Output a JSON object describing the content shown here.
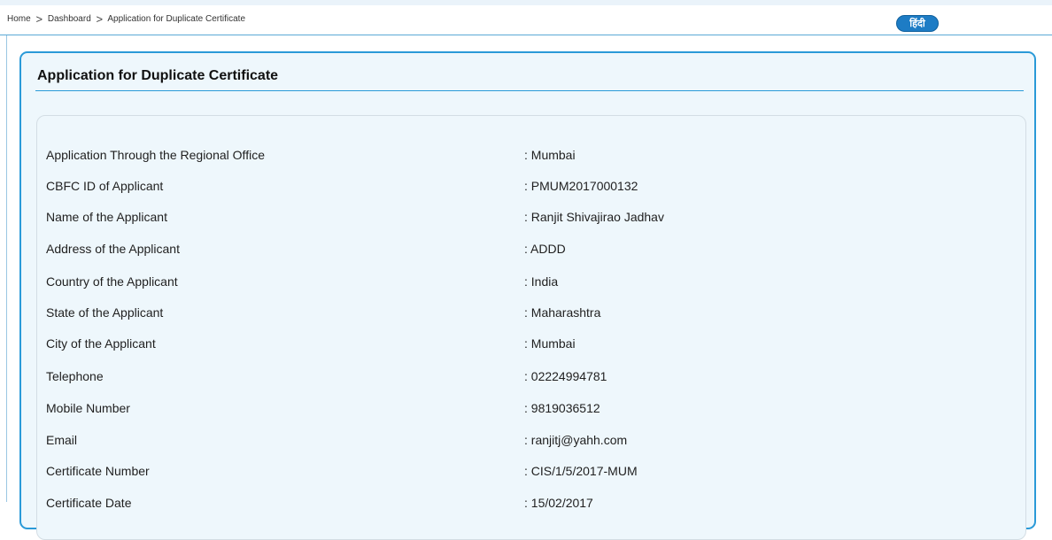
{
  "breadcrumb": {
    "home": "Home",
    "separator": ">",
    "dashboard": "Dashboard",
    "current": "Application for Duplicate Certificate"
  },
  "language_button": "हिंदी",
  "panel": {
    "title": "Application for Duplicate Certificate"
  },
  "details": [
    {
      "label": "Application Through the Regional Office",
      "value": ": Mumbai"
    },
    {
      "label": "CBFC ID of Applicant",
      "value": ": PMUM2017000132"
    },
    {
      "label": "Name of the Applicant",
      "value": ": Ranjit Shivajirao Jadhav"
    },
    {
      "label": "Address of the Applicant",
      "value": ": ADDD"
    },
    {
      "label": "Country of the Applicant",
      "value": ": India"
    },
    {
      "label": "State of the Applicant",
      "value": ": Maharashtra"
    },
    {
      "label": "City of the Applicant",
      "value": ": Mumbai"
    },
    {
      "label": "Telephone",
      "value": ": 02224994781"
    },
    {
      "label": "Mobile Number",
      "value": ": 9819036512"
    },
    {
      "label": "Email",
      "value": ": ranjitj@yahh.com"
    },
    {
      "label": "Certificate Number",
      "value": ": CIS/1/5/2017-MUM"
    },
    {
      "label": "Certificate Date",
      "value": ": 15/02/2017"
    }
  ],
  "colors": {
    "accent": "#2a9ad8",
    "panel_background": "#eef7fc",
    "language_button": "#1d7cc5"
  }
}
